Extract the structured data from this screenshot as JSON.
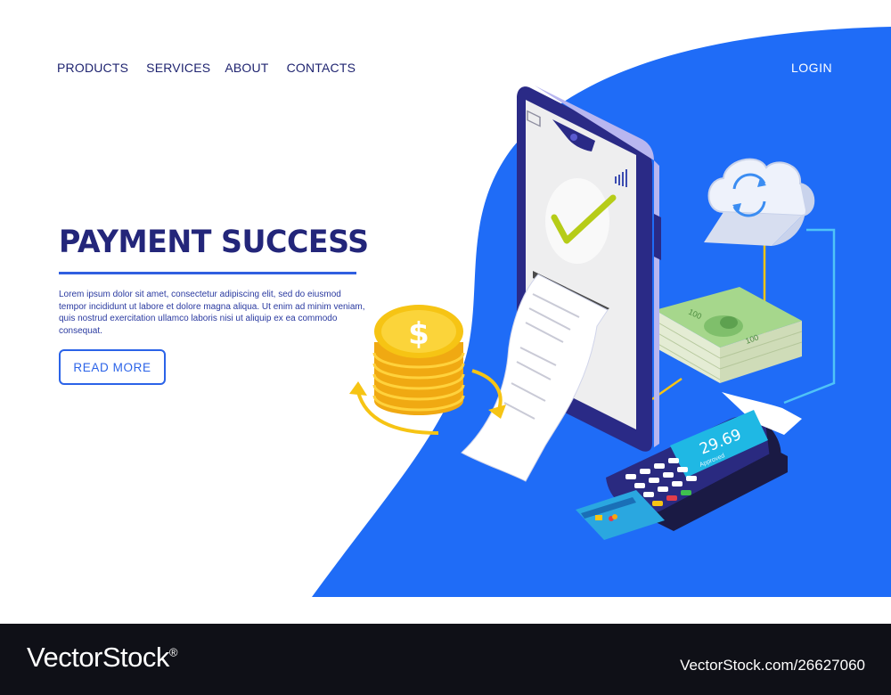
{
  "nav": {
    "items": [
      {
        "label": "PRODUCTS"
      },
      {
        "label": "SERVICES"
      },
      {
        "label": "ABOUT"
      },
      {
        "label": "CONTACTS"
      }
    ],
    "login_label": "LOGIN"
  },
  "hero": {
    "title": "PAYMENT SUCCESS",
    "description": "Lorem ipsum dolor sit amet, consectetur adipiscing elit, sed do eiusmod tempor incididunt ut labore et dolore magna aliqua. Ut enim ad minim veniam, quis nostrud exercitation ullamco laboris nisi ut aliquip ex ea commodo consequat.",
    "button_label": "READ  MORE"
  },
  "illustration": {
    "terminal_amount": "29.69",
    "terminal_status": "Approved",
    "banknote_value": "100",
    "coin_symbol": "$"
  },
  "colors": {
    "brand_blue": "#1f6cf7",
    "title_navy": "#23267a",
    "accent_yellow": "#f6c414",
    "check_green": "#b6cc18"
  },
  "footer": {
    "brand": "VectorStock",
    "registered_mark": "®",
    "credit": "VectorStock.com/26627060"
  }
}
